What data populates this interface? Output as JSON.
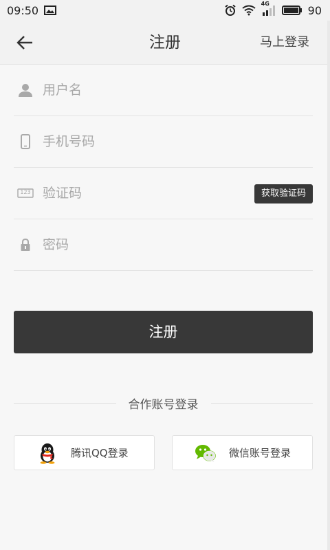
{
  "status_bar": {
    "time": "09:50",
    "network": "4G",
    "battery": "90"
  },
  "header": {
    "title": "注册",
    "login_link": "马上登录"
  },
  "form": {
    "username_placeholder": "用户名",
    "phone_placeholder": "手机号码",
    "code_placeholder": "验证码",
    "get_code_label": "获取验证码",
    "password_placeholder": "密码",
    "code_icon_text": "123"
  },
  "register_button": "注册",
  "partner": {
    "divider_text": "合作账号登录",
    "qq_label": "腾讯QQ登录",
    "wechat_label": "微信账号登录"
  },
  "colors": {
    "button_dark": "#383838",
    "background": "#f7f7f7"
  }
}
